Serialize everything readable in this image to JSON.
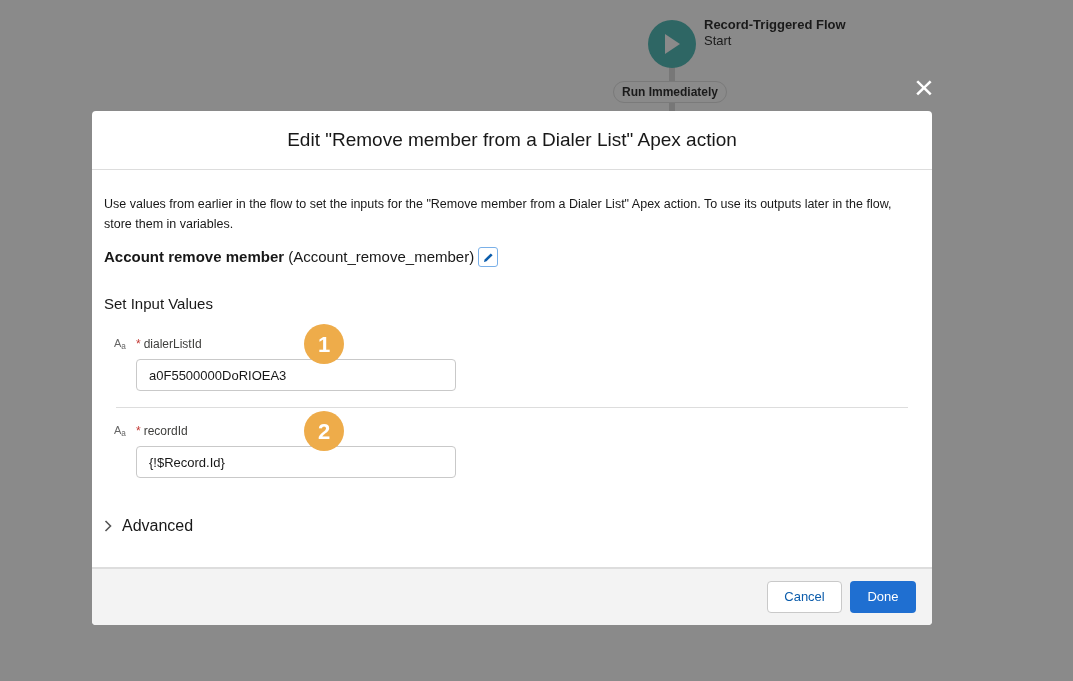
{
  "canvas": {
    "start_node": {
      "title": "Record-Triggered Flow",
      "subtitle": "Start"
    },
    "path_label": "Run Immediately"
  },
  "close_icon": "×",
  "modal": {
    "title": "Edit \"Remove member from a Dialer List\" Apex action",
    "description": "Use values from earlier in the flow to set the inputs for the \"Remove member from a Dialer List\" Apex action. To use its outputs later in the flow, store them in variables.",
    "action_label": "Account remove member",
    "action_api_name": "(Account_remove_member)",
    "section_title": "Set Input Values",
    "fields": [
      {
        "type_icon": "A$_{a}$",
        "required_mark": "*",
        "label": "dialerListId",
        "value": "a0F5500000DoRIOEA3",
        "badge": "1"
      },
      {
        "type_icon": "A$_{a}$",
        "required_mark": "*",
        "label": "recordId",
        "value": "{!$Record.Id}",
        "badge": "2"
      }
    ],
    "advanced": {
      "label": "Advanced",
      "expanded": false
    },
    "buttons": [
      {
        "label": "Cancel",
        "kind": "neutral"
      },
      {
        "label": "Done",
        "kind": "brand"
      }
    ]
  }
}
